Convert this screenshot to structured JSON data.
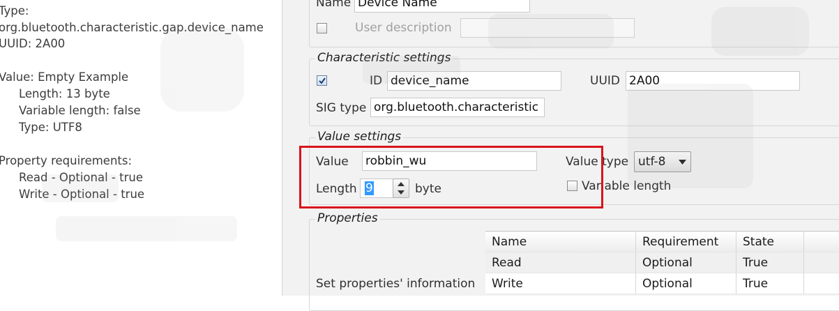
{
  "info_panel": {
    "type_label": "Type:",
    "type_value": "org.bluetooth.characteristic.gap.device_name",
    "uuid_line": "UUID: 2A00",
    "value_line": "Value: Empty Example",
    "length_line": "Length: 13 byte",
    "variable_length_line": "Variable length: false",
    "type_line": "Type: UTF8",
    "property_requirements_label": "Property requirements:",
    "property_lines": [
      "Read - Optional - true",
      "Write - Optional - true"
    ]
  },
  "top_fields": {
    "name_label": "Name",
    "name_value": "Device Name",
    "user_description_label": "User description",
    "user_description_checked": false,
    "user_description_value": ""
  },
  "characteristic_settings": {
    "title": "Characteristic settings",
    "id_checked": true,
    "id_label": "ID",
    "id_value": "device_name",
    "uuid_label": "UUID",
    "uuid_value": "2A00",
    "sig_type_label": "SIG type",
    "sig_type_value": "org.bluetooth.characteristic"
  },
  "value_settings": {
    "title": "Value settings",
    "value_label": "Value",
    "value_value": "robbin_wu",
    "value_type_label": "Value type",
    "value_type_selected": "utf-8",
    "length_label": "Length",
    "length_value": "9",
    "length_unit": "byte",
    "variable_length_label": "Variable length",
    "variable_length_checked": false
  },
  "properties": {
    "title": "Properties",
    "set_info_label": "Set properties' information",
    "columns": [
      "Name",
      "Requirement",
      "State"
    ],
    "rows": [
      {
        "name": "Read",
        "requirement": "Optional",
        "state": "True"
      },
      {
        "name": "Write",
        "requirement": "Optional",
        "state": "True"
      }
    ]
  },
  "colors": {
    "highlight": "#d9141c",
    "panel_bg": "#f2f2f2",
    "selection": "#3399ff"
  }
}
